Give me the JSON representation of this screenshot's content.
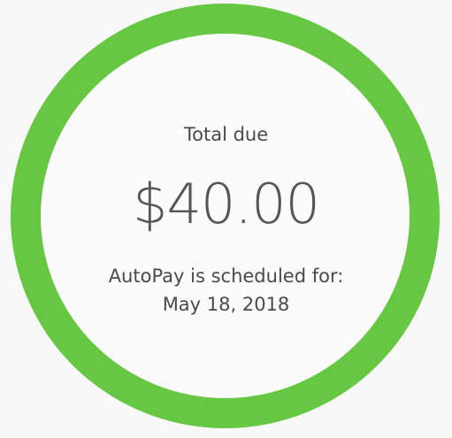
{
  "colors": {
    "ring": "#66c742",
    "text": "#4a4a4a",
    "background": "#f8f8f8"
  },
  "summary": {
    "total_label": "Total due",
    "amount": "$40.00",
    "autopay_label": "AutoPay is scheduled for:",
    "autopay_date": "May 18, 2018"
  }
}
